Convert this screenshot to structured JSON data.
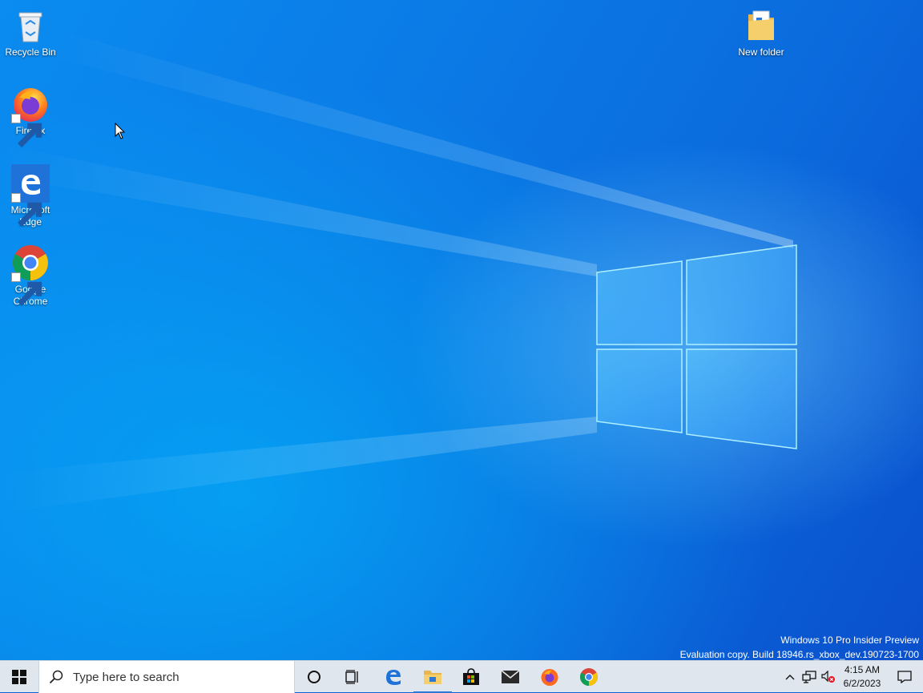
{
  "desktop": {
    "icons": [
      {
        "label": "Recycle Bin",
        "icon": "recycle-bin-icon"
      },
      {
        "label": "Firefox",
        "icon": "firefox-icon"
      },
      {
        "label": "Microsoft Edge",
        "icon": "edge-icon"
      },
      {
        "label": "Google Chrome",
        "icon": "chrome-icon"
      },
      {
        "label": "New folder",
        "icon": "folder-icon"
      }
    ],
    "watermark": {
      "line1": "Windows 10 Pro Insider Preview",
      "line2": "Evaluation copy. Build 18946.rs_xbox_dev.190723-1700"
    }
  },
  "taskbar": {
    "search_placeholder": "Type here to search",
    "pinned": [
      "start-icon",
      "cortana-icon",
      "task-view-icon",
      "edge-icon",
      "file-explorer-icon",
      "store-icon",
      "mail-icon",
      "firefox-icon",
      "chrome-icon"
    ],
    "clock": {
      "time": "4:15 AM",
      "date": "6/2/2023"
    }
  },
  "colors": {
    "accent": "#2b78d6",
    "taskbar_bg": "#dfe6ee",
    "wallpaper": "#0b7be6"
  }
}
